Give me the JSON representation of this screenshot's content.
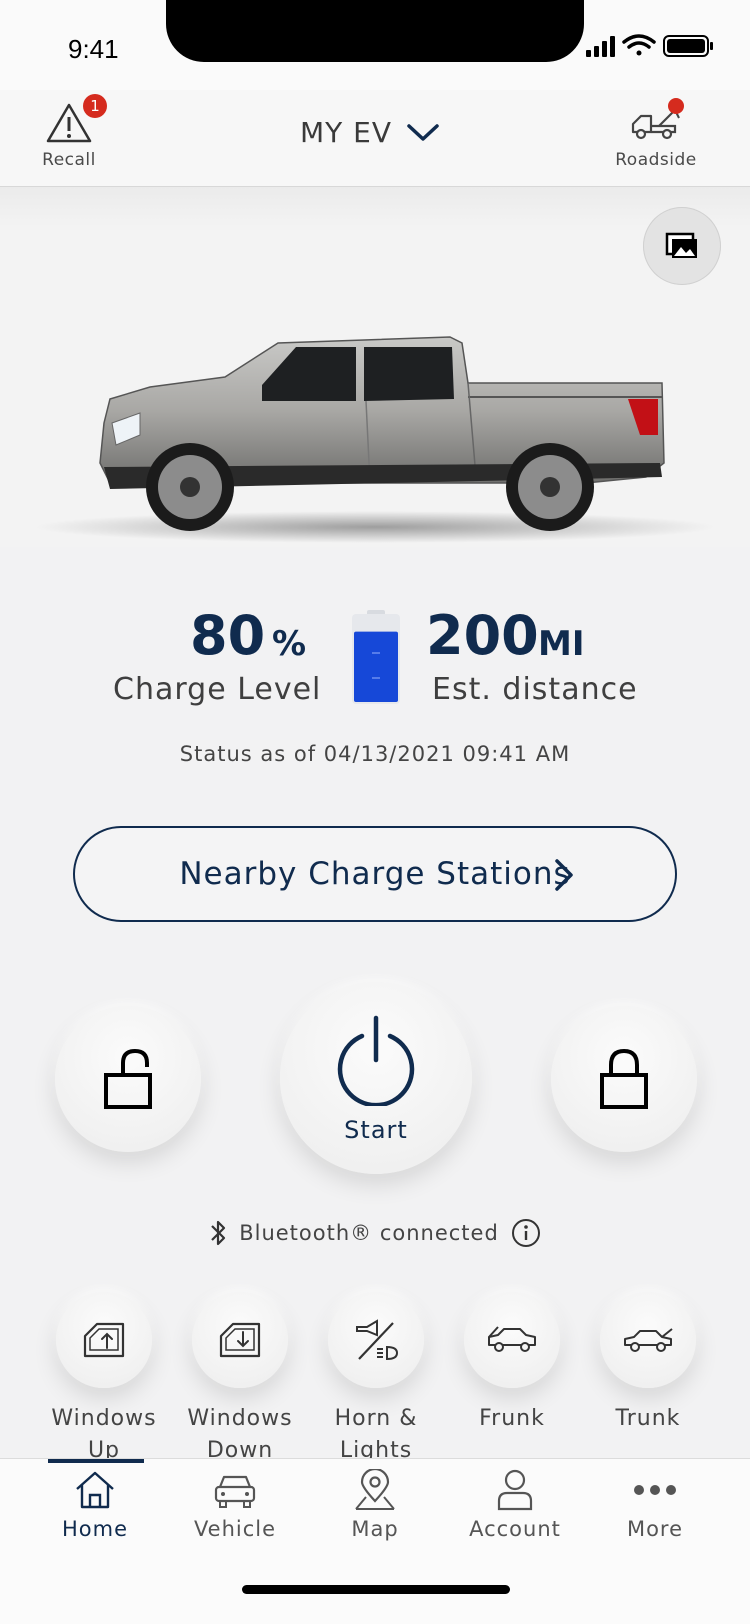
{
  "status_bar": {
    "time": "9:41"
  },
  "header": {
    "recall_label": "Recall",
    "recall_count": "1",
    "vehicle_name": "MY EV",
    "roadside_label": "Roadside"
  },
  "charge": {
    "level_value": "80",
    "level_unit": "%",
    "level_label": "Charge Level",
    "level_fraction": 0.8,
    "distance_value": "200",
    "distance_unit": "MI",
    "distance_label": "Est. distance",
    "status_text": "Status as of 04/13/2021 09:41 AM"
  },
  "nearby_label": "Nearby Charge Stations",
  "controls": {
    "start_label": "Start"
  },
  "bluetooth_text": "Bluetooth® connected",
  "quick_actions": [
    {
      "line1": "Windows",
      "line2": "Up"
    },
    {
      "line1": "Windows",
      "line2": "Down"
    },
    {
      "line1": "Horn &",
      "line2": "Lights"
    },
    {
      "line1": "Frunk",
      "line2": ""
    },
    {
      "line1": "Trunk",
      "line2": ""
    }
  ],
  "nav": [
    "Home",
    "Vehicle",
    "Map",
    "Account",
    "More"
  ],
  "colors": {
    "navy": "#102b4e",
    "alert_red": "#d52b1e",
    "battery_blue": "#1648d8"
  }
}
